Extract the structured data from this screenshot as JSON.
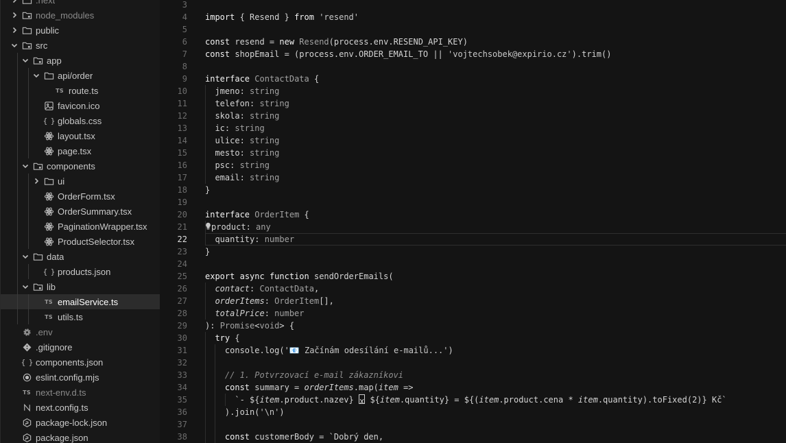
{
  "explorer": {
    "items": [
      {
        "label": ".next",
        "depth": 0,
        "kind": "folder-icon",
        "chevron": "right",
        "dim": true
      },
      {
        "label": "node_modules",
        "depth": 0,
        "kind": "folder-special-icon",
        "chevron": "right",
        "dim": true
      },
      {
        "label": "public",
        "depth": 0,
        "kind": "folder-icon",
        "chevron": "right"
      },
      {
        "label": "src",
        "depth": 0,
        "kind": "folder-special-icon",
        "chevron": "down"
      },
      {
        "label": "app",
        "depth": 1,
        "kind": "folder-special-icon",
        "chevron": "down"
      },
      {
        "label": "api/order",
        "depth": 2,
        "kind": "folder-icon",
        "chevron": "down"
      },
      {
        "label": "route.ts",
        "depth": 3,
        "kind": "ts-file-icon",
        "chevron": "none"
      },
      {
        "label": "favicon.ico",
        "depth": 2,
        "kind": "image-file-icon",
        "chevron": "none"
      },
      {
        "label": "globals.css",
        "depth": 2,
        "kind": "braces-file-icon",
        "chevron": "none"
      },
      {
        "label": "layout.tsx",
        "depth": 2,
        "kind": "react-file-icon",
        "chevron": "none"
      },
      {
        "label": "page.tsx",
        "depth": 2,
        "kind": "react-file-icon",
        "chevron": "none"
      },
      {
        "label": "components",
        "depth": 1,
        "kind": "folder-special-icon",
        "chevron": "down"
      },
      {
        "label": "ui",
        "depth": 2,
        "kind": "folder-icon",
        "chevron": "right"
      },
      {
        "label": "OrderForm.tsx",
        "depth": 2,
        "kind": "react-file-icon",
        "chevron": "none"
      },
      {
        "label": "OrderSummary.tsx",
        "depth": 2,
        "kind": "react-file-icon",
        "chevron": "none"
      },
      {
        "label": "PaginationWrapper.tsx",
        "depth": 2,
        "kind": "react-file-icon",
        "chevron": "none"
      },
      {
        "label": "ProductSelector.tsx",
        "depth": 2,
        "kind": "react-file-icon",
        "chevron": "none"
      },
      {
        "label": "data",
        "depth": 1,
        "kind": "folder-icon",
        "chevron": "down"
      },
      {
        "label": "products.json",
        "depth": 2,
        "kind": "braces-file-icon",
        "chevron": "none"
      },
      {
        "label": "lib",
        "depth": 1,
        "kind": "folder-special-icon",
        "chevron": "down"
      },
      {
        "label": "emailService.ts",
        "depth": 2,
        "kind": "ts-file-icon",
        "chevron": "none",
        "selected": true
      },
      {
        "label": "utils.ts",
        "depth": 2,
        "kind": "ts-file-icon",
        "chevron": "none"
      },
      {
        "label": ".env",
        "depth": 0,
        "kind": "gear-file-icon",
        "chevron": "none",
        "dim": true
      },
      {
        "label": ".gitignore",
        "depth": 0,
        "kind": "git-file-icon",
        "chevron": "none"
      },
      {
        "label": "components.json",
        "depth": 0,
        "kind": "braces-file-icon",
        "chevron": "none"
      },
      {
        "label": "eslint.config.mjs",
        "depth": 0,
        "kind": "circle-file-icon",
        "chevron": "none"
      },
      {
        "label": "next-env.d.ts",
        "depth": 0,
        "kind": "ts-file-icon",
        "chevron": "none",
        "dim": true
      },
      {
        "label": "next.config.ts",
        "depth": 0,
        "kind": "next-file-icon",
        "chevron": "none"
      },
      {
        "label": "package-lock.json",
        "depth": 0,
        "kind": "package-file-icon",
        "chevron": "none"
      },
      {
        "label": "package.json",
        "depth": 0,
        "kind": "package-file-icon",
        "chevron": "none"
      }
    ]
  },
  "editor": {
    "active_line": 22,
    "lines": [
      {
        "n": "3",
        "t": ""
      },
      {
        "n": "4",
        "t": "import { Resend } from 'resend'"
      },
      {
        "n": "5",
        "t": ""
      },
      {
        "n": "6",
        "t": "const resend = new Resend(process.env.RESEND_API_KEY)"
      },
      {
        "n": "7",
        "t": "const shopEmail = (process.env.ORDER_EMAIL_TO || 'vojtechsobek@expirio.cz').trim()"
      },
      {
        "n": "8",
        "t": ""
      },
      {
        "n": "9",
        "t": "interface ContactData {"
      },
      {
        "n": "10",
        "t": "  jmeno: string"
      },
      {
        "n": "11",
        "t": "  telefon: string"
      },
      {
        "n": "12",
        "t": "  skola: string"
      },
      {
        "n": "13",
        "t": "  ic: string"
      },
      {
        "n": "14",
        "t": "  ulice: string"
      },
      {
        "n": "15",
        "t": "  mesto: string"
      },
      {
        "n": "16",
        "t": "  psc: string"
      },
      {
        "n": "17",
        "t": "  email: string"
      },
      {
        "n": "18",
        "t": "}"
      },
      {
        "n": "19",
        "t": ""
      },
      {
        "n": "20",
        "t": "interface OrderItem {"
      },
      {
        "n": "21",
        "t": "product: any"
      },
      {
        "n": "22",
        "t": "  quantity: number"
      },
      {
        "n": "23",
        "t": "}"
      },
      {
        "n": "24",
        "t": ""
      },
      {
        "n": "25",
        "t": "export async function sendOrderEmails("
      },
      {
        "n": "26",
        "t": "  contact: ContactData,"
      },
      {
        "n": "27",
        "t": "  orderItems: OrderItem[],"
      },
      {
        "n": "28",
        "t": "  totalPrice: number"
      },
      {
        "n": "29",
        "t": "): Promise<void> {"
      },
      {
        "n": "30",
        "t": "  try {"
      },
      {
        "n": "31",
        "t": "    console.log('📧 Začínám odesílání e-mailů...')"
      },
      {
        "n": "32",
        "t": ""
      },
      {
        "n": "33",
        "t": "    // 1. Potvrzovací e-mail zákazníkovi"
      },
      {
        "n": "34",
        "t": "    const summary = orderItems.map(item =>"
      },
      {
        "n": "35",
        "t": "      `- ${item.product.nazev} x ${item.quantity} = ${(item.product.cena * item.quantity).toFixed(2)} Kč`"
      },
      {
        "n": "36",
        "t": "    ).join('\\n')"
      },
      {
        "n": "37",
        "t": ""
      },
      {
        "n": "38",
        "t": "    const customerBody = `Dobrý den,"
      }
    ]
  }
}
